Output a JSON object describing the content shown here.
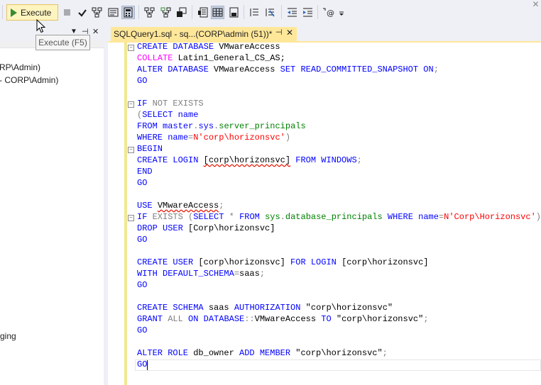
{
  "toolbar": {
    "execute_label": "Execute",
    "execute_tooltip": "Execute (F5)",
    "stop_icon": "stop-icon",
    "parse_icon": "checkmark-icon"
  },
  "left_pane": {
    "lines": [
      "RP\\Admin)",
      "- CORP\\Admin)",
      "ging"
    ]
  },
  "tab": {
    "title": "SQLQuery1.sql - sq...(CORP\\admin (51))*",
    "pin_glyph": "⊣",
    "close_glyph": "✕"
  },
  "code": {
    "l1_a": "CREATE DATABASE ",
    "l1_b": "VMwareAccess",
    "l2_a": "COLLATE ",
    "l2_b": "Latin1_General_CS_AS;",
    "l3_a": "ALTER DATABASE ",
    "l3_b": "VMwareAccess ",
    "l3_c": "SET READ_COMMITTED_SNAPSHOT ON",
    "l3_d": ";",
    "go": "GO",
    "l6_a": "IF ",
    "l6_b": "NOT EXISTS",
    "l7_a": "(",
    "l7_b": "SELECT ",
    "l7_c": "name",
    "l8_a": "FROM ",
    "l8_b": "master",
    "l8_c": ".",
    "l8_d": "sys",
    "l8_e": ".",
    "l8_f": "server_principals",
    "l9_a": "WHERE ",
    "l9_b": "name",
    "l9_c": "=",
    "l9_d": "N'corp\\horizonsvc'",
    "l9_e": ")",
    "l10": "BEGIN",
    "l11_a": "CREATE LOGIN ",
    "l11_b": "[corp\\horizonsvc]",
    "l11_c": " FROM WINDOWS",
    "l11_d": ";",
    "l12": "END",
    "l15_a": "USE ",
    "l15_b": "VMwareAccess",
    "l15_c": ";",
    "l16_a": "IF ",
    "l16_b": "EXISTS ",
    "l16_c": "(",
    "l16_d": "SELECT ",
    "l16_e": "* ",
    "l16_f": "FROM ",
    "l16_g": "sys",
    "l16_h": ".",
    "l16_i": "database_principals ",
    "l16_j": "WHERE ",
    "l16_k": "name",
    "l16_l": "=",
    "l16_m": "N'Corp\\Horizonsvc'",
    "l16_n": ")",
    "l17_a": "DROP USER ",
    "l17_b": "[Corp\\horizonsvc]",
    "l20_a": "CREATE USER ",
    "l20_b": "[corp\\horizonsvc]",
    "l20_c": " FOR LOGIN ",
    "l20_d": "[corp\\horizonsvc]",
    "l21_a": "WITH DEFAULT_SCHEMA",
    "l21_b": "=",
    "l21_c": "saas",
    "l21_d": ";",
    "l24_a": "CREATE SCHEMA ",
    "l24_b": "saas ",
    "l24_c": "AUTHORIZATION ",
    "l24_d": "\"corp\\horizonsvc\"",
    "l25_a": "GRANT ",
    "l25_b": "ALL ",
    "l25_c": "ON DATABASE",
    "l25_d": "::",
    "l25_e": "VMwareAccess ",
    "l25_f": "TO ",
    "l25_g": "\"corp\\horizonsvc\"",
    "l25_h": ";",
    "l28_a": "ALTER ROLE ",
    "l28_b": "db_owner ",
    "l28_c": "ADD MEMBER ",
    "l28_d": "\"corp\\horizonsvc\"",
    "l28_e": ";"
  },
  "colors": {
    "accent_tab": "#ffe79a",
    "keyword": "#0000ff",
    "string": "#ff0000",
    "function": "#ff00ff",
    "system": "#008000"
  }
}
